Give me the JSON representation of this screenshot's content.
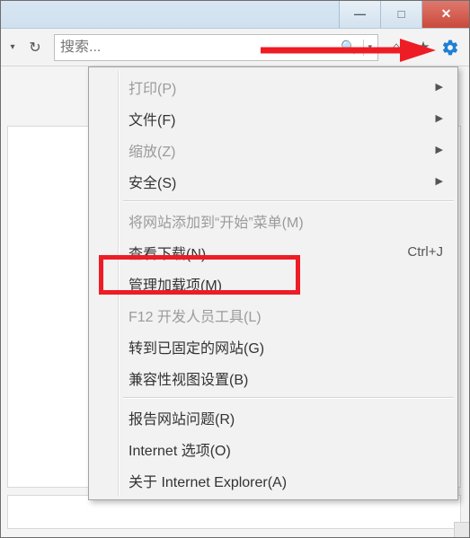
{
  "window": {
    "min_glyph": "—",
    "max_glyph": "□",
    "close_glyph": "✕"
  },
  "toolbar": {
    "dropdown_glyph": "▾",
    "refresh_glyph": "↻",
    "search_placeholder": "搜索...",
    "search_icon_glyph": "🔍",
    "search_dd_glyph": "▾",
    "home_glyph": "⌂",
    "star_glyph": "★"
  },
  "menu": {
    "items": [
      {
        "label": "打印(P)",
        "disabled": true,
        "submenu": true
      },
      {
        "label": "文件(F)",
        "submenu": true
      },
      {
        "label": "缩放(Z)",
        "disabled": true,
        "submenu": true
      },
      {
        "label": "安全(S)",
        "submenu": true
      },
      {
        "sep": true
      },
      {
        "label": "将网站添加到“开始”菜单(M)",
        "disabled": true
      },
      {
        "label": "查看下载(N)",
        "shortcut": "Ctrl+J"
      },
      {
        "label": "管理加载项(M)",
        "highlight": true
      },
      {
        "label": "F12 开发人员工具(L)",
        "disabled": true
      },
      {
        "label": "转到已固定的网站(G)"
      },
      {
        "label": "兼容性视图设置(B)"
      },
      {
        "sep": true
      },
      {
        "label": "报告网站问题(R)"
      },
      {
        "label": "Internet 选项(O)"
      },
      {
        "label": "关于 Internet Explorer(A)"
      }
    ],
    "submenu_glyph": "▶"
  }
}
